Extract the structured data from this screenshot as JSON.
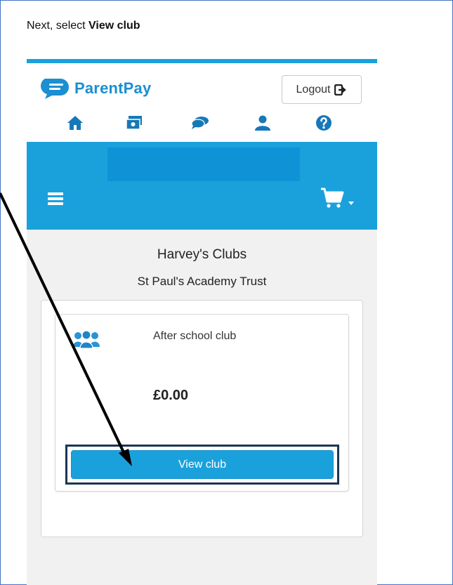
{
  "instruction": {
    "prefix": "Next, select ",
    "emphasis": "View club"
  },
  "header": {
    "logo_text": "ParentPay",
    "logout_label": "Logout",
    "nav_icons": [
      "home-icon",
      "payments-icon",
      "messages-icon",
      "profile-icon",
      "help-icon"
    ]
  },
  "banner": {
    "menu_icon": "hamburger-menu-icon",
    "cart_icon": "shopping-cart-icon"
  },
  "clubs": {
    "heading": "Harvey's Clubs",
    "organisation": "St Paul's Academy Trust",
    "items": [
      {
        "name": "After school club",
        "price": "£0.00",
        "button_label": "View club",
        "icon": "group-icon"
      }
    ]
  },
  "colors": {
    "brand_blue": "#1aa1dc",
    "logo_blue": "#1a8fd1",
    "nav_icon_blue": "#1778b8",
    "highlight_border": "#1c3553",
    "frame_border": "#4472c4"
  }
}
